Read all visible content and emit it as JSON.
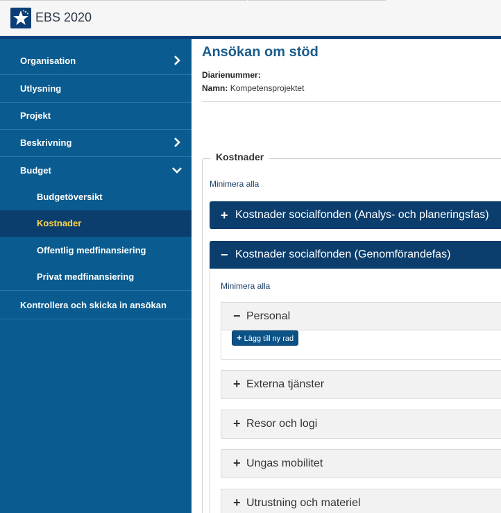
{
  "app": {
    "title": "EBS 2020"
  },
  "sidebar": {
    "items": [
      {
        "label": "Organisation"
      },
      {
        "label": "Utlysning"
      },
      {
        "label": "Projekt"
      },
      {
        "label": "Beskrivning"
      },
      {
        "label": "Budget"
      },
      {
        "label": "Kontrollera och skicka in ansökan"
      }
    ],
    "budget_sub": [
      {
        "label": "Budgetöversikt"
      },
      {
        "label": "Kostnader"
      },
      {
        "label": "Offentlig medfinansiering"
      },
      {
        "label": "Privat medfinansiering"
      }
    ]
  },
  "page": {
    "title": "Ansökan om stöd",
    "diarienummer_label": "Diarienummer:",
    "diarienummer_value": "",
    "namn_label": "Namn:",
    "namn_value": "Kompetensprojektet"
  },
  "costs": {
    "legend": "Kostnader",
    "minimize_all": "Minimera alla",
    "sections": [
      {
        "title": "Kostnader socialfonden (Analys- och planeringsfas)",
        "icon": "+"
      },
      {
        "title": "Kostnader socialfonden (Genomförandefas)",
        "icon": "−"
      }
    ],
    "inner_minimize_all": "Minimera alla",
    "panels": [
      {
        "title": "Personal",
        "icon": "−"
      },
      {
        "title": "Externa tjänster",
        "icon": "+"
      },
      {
        "title": "Resor och logi",
        "icon": "+"
      },
      {
        "title": "Ungas mobilitet",
        "icon": "+"
      },
      {
        "title": "Utrustning och materiel",
        "icon": "+"
      }
    ],
    "add_row_label": "Lägg till ny rad",
    "add_icon": "+"
  },
  "colors": {
    "sidebar_bg": "#0a5b8f",
    "active_bg": "#0b3e6d",
    "active_text": "#ffd64a",
    "accordion_head": "#0b3e6d",
    "title_blue": "#1c5c8c"
  }
}
